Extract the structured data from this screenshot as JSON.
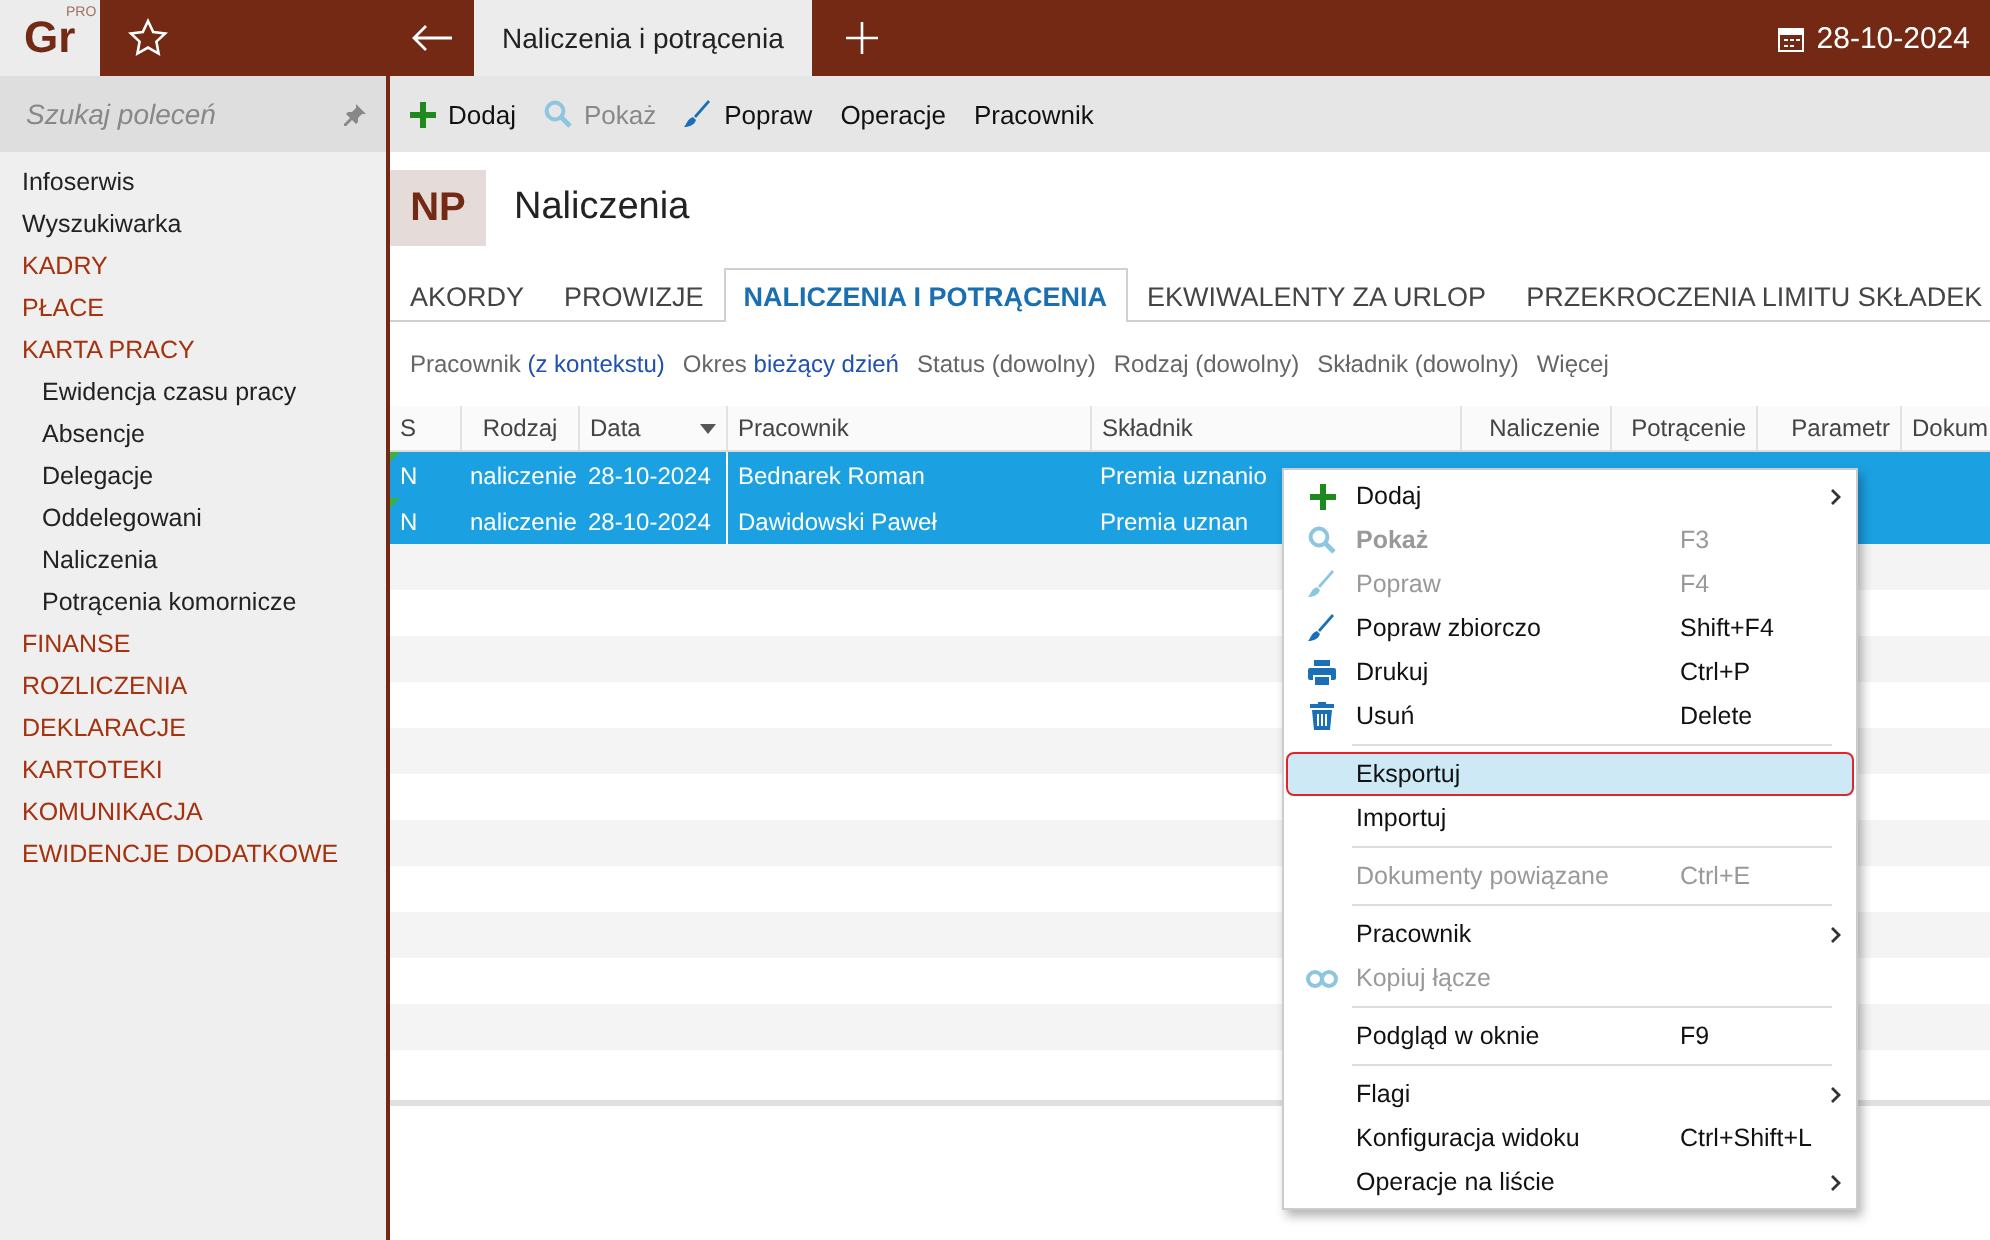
{
  "logo": {
    "text": "Gr",
    "sup": "PRO"
  },
  "tabs": [
    {
      "label": "Naliczenia i potrącenia",
      "selected": true
    }
  ],
  "date": "28-10-2024",
  "sidebar": {
    "search": {
      "placeholder": "Szukaj poleceń"
    },
    "items": [
      {
        "label": "Infoserwis",
        "kind": "link"
      },
      {
        "label": "Wyszukiwarka",
        "kind": "link"
      },
      {
        "label": "KADRY",
        "kind": "section"
      },
      {
        "label": "PŁACE",
        "kind": "section"
      },
      {
        "label": "KARTA PRACY",
        "kind": "section",
        "children": [
          {
            "label": "Ewidencja czasu pracy"
          },
          {
            "label": "Absencje"
          },
          {
            "label": "Delegacje"
          },
          {
            "label": "Oddelegowani"
          },
          {
            "label": "Naliczenia"
          },
          {
            "label": "Potrącenia komornicze"
          }
        ]
      },
      {
        "label": "FINANSE",
        "kind": "section"
      },
      {
        "label": "ROZLICZENIA",
        "kind": "section"
      },
      {
        "label": "DEKLARACJE",
        "kind": "section"
      },
      {
        "label": "KARTOTEKI",
        "kind": "section"
      },
      {
        "label": "KOMUNIKACJA",
        "kind": "section"
      },
      {
        "label": "EWIDENCJE DODATKOWE",
        "kind": "section"
      }
    ]
  },
  "toolbar": [
    {
      "label": "Dodaj",
      "disabled": false
    },
    {
      "label": "Pokaż",
      "disabled": true
    },
    {
      "label": "Popraw",
      "disabled": false
    },
    {
      "label": "Operacje",
      "disabled": false
    },
    {
      "label": "Pracownik",
      "disabled": false
    }
  ],
  "page": {
    "badge": "NP",
    "title": "Naliczenia"
  },
  "subtabs": [
    {
      "label": "AKORDY",
      "selected": false
    },
    {
      "label": "PROWIZJE",
      "selected": false
    },
    {
      "label": "NALICZENIA I POTRĄCENIA",
      "selected": true
    },
    {
      "label": "EKWIWALENTY ZA URLOP",
      "selected": false
    },
    {
      "label": "PRZEKROCZENIA LIMITU SKŁADEK",
      "selected": false
    }
  ],
  "filters": [
    {
      "label": "Pracownik",
      "value": "(z kontekstu)",
      "active": true
    },
    {
      "label": "Okres",
      "value": "bieżący dzień",
      "active": true
    },
    {
      "label": "Status",
      "value": "(dowolny)",
      "active": false
    },
    {
      "label": "Rodzaj",
      "value": "(dowolny)",
      "active": false
    },
    {
      "label": "Składnik",
      "value": "(dowolny)",
      "active": false
    }
  ],
  "more": "Więcej",
  "table": {
    "columns": [
      "S",
      "Rodzaj",
      "Data",
      "Pracownik",
      "Składnik",
      "Naliczenie",
      "Potrącenie",
      "Parametr",
      "Dokum"
    ],
    "rows": [
      {
        "selected": true,
        "cells": [
          "N",
          "naliczenie",
          "28-10-2024",
          "Bednarek Roman",
          "Premia uznanio"
        ]
      },
      {
        "selected": true,
        "cells": [
          "N",
          "naliczenie",
          "28-10-2024",
          "Dawidowski Paweł",
          "Premia uznan"
        ]
      }
    ]
  },
  "context_menu": [
    {
      "kind": "item",
      "label": "Dodaj",
      "submenu": true,
      "disabled": false,
      "selected": false
    },
    {
      "kind": "item",
      "label": "Pokaż",
      "shortcut": "F3",
      "disabled": true,
      "selected": false
    },
    {
      "kind": "item",
      "label": "Popraw",
      "shortcut": "F4",
      "disabled": true,
      "selected": false
    },
    {
      "kind": "item",
      "label": "Popraw zbiorczo",
      "shortcut": "Shift+F4",
      "disabled": false,
      "selected": false
    },
    {
      "kind": "item",
      "label": "Drukuj",
      "shortcut": "Ctrl+P",
      "disabled": false,
      "selected": false
    },
    {
      "kind": "item",
      "label": "Usuń",
      "shortcut": "Delete",
      "disabled": false,
      "selected": false
    },
    {
      "kind": "separator"
    },
    {
      "kind": "item",
      "label": "Eksportuj",
      "disabled": false,
      "selected": true
    },
    {
      "kind": "item",
      "label": "Importuj",
      "disabled": false,
      "selected": false
    },
    {
      "kind": "separator"
    },
    {
      "kind": "item",
      "label": "Dokumenty powiązane",
      "shortcut": "Ctrl+E",
      "disabled": true,
      "selected": false
    },
    {
      "kind": "separator"
    },
    {
      "kind": "item",
      "label": "Pracownik",
      "submenu": true,
      "disabled": false,
      "selected": false
    },
    {
      "kind": "item",
      "label": "Kopiuj łącze",
      "disabled": true,
      "selected": false
    },
    {
      "kind": "separator"
    },
    {
      "kind": "item",
      "label": "Podgląd w oknie",
      "shortcut": "F9",
      "disabled": false,
      "selected": false
    },
    {
      "kind": "separator"
    },
    {
      "kind": "item",
      "label": "Flagi",
      "submenu": true,
      "disabled": false,
      "selected": false
    },
    {
      "kind": "item",
      "label": "Konfiguracja widoku",
      "shortcut": "Ctrl+Shift+L",
      "disabled": false,
      "selected": false
    },
    {
      "kind": "item",
      "label": "Operacje na liście",
      "submenu": true,
      "disabled": false,
      "selected": false
    }
  ]
}
